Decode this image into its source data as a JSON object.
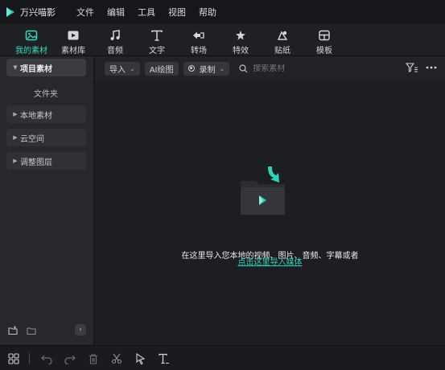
{
  "titlebar": {
    "app_name": "万兴喵影",
    "menu": [
      "文件",
      "编辑",
      "工具",
      "视图",
      "帮助"
    ]
  },
  "toolbar": {
    "tabs": [
      {
        "label": "我的素材",
        "icon": "my-media-icon",
        "active": true
      },
      {
        "label": "素材库",
        "icon": "stock-library-icon"
      },
      {
        "label": "音频",
        "icon": "audio-icon"
      },
      {
        "label": "文字",
        "icon": "text-icon"
      },
      {
        "label": "转场",
        "icon": "transition-icon"
      },
      {
        "label": "特效",
        "icon": "effects-icon"
      },
      {
        "label": "贴纸",
        "icon": "sticker-icon"
      },
      {
        "label": "模板",
        "icon": "template-icon"
      }
    ],
    "accent_color": "#38d9be"
  },
  "sidebar": {
    "items": [
      {
        "label": "项目素材",
        "expanded": true
      },
      {
        "label": "本地素材"
      },
      {
        "label": "云空间"
      },
      {
        "label": "调整图层"
      }
    ],
    "sub_item": "文件夹"
  },
  "filterbar": {
    "import_label": "导入",
    "ai_label": "AI绘图",
    "record_label": "录制",
    "search_placeholder": "搜索素材"
  },
  "empty_state": {
    "text": "在这里导入您本地的视频、图片、音频、字幕或者",
    "link": "点击这里导入媒体"
  }
}
